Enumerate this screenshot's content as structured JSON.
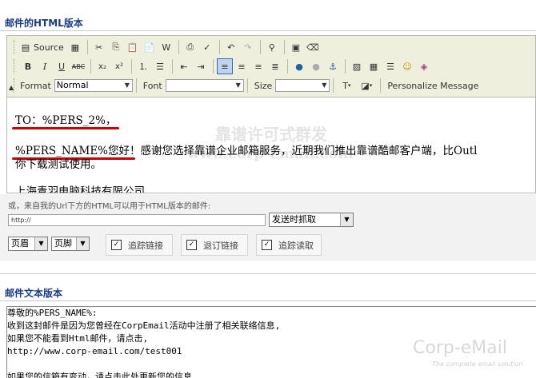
{
  "html_section": {
    "title": "邮件的HTML版本"
  },
  "toolbar": {
    "source_label": "Source",
    "format_label": "Format",
    "format_value": "Normal",
    "font_label": "Font",
    "font_value": "",
    "size_label": "Size",
    "size_value": "",
    "personalize_label": "Personalize Message"
  },
  "content": {
    "line1": "TO：%PERS_2%，",
    "line2_var": "%PERS_NAME%您好",
    "line2_rest": "！感谢您选择靠谱企业邮箱服务，近期我们推出靠谱酷邮客户端，比Outl",
    "line3": "你下载测试使用。",
    "line4": "上海青羽电脑科技有限公司",
    "watermark_cn": "靠谱许可式群发",
    "watermark_url": "www.corp-email.com"
  },
  "url_panel": {
    "label": "或，来自我的Url下方的HTML可以用于HTML版本的邮件:",
    "url_value": "http://",
    "fetch_select": "发送时抓取"
  },
  "options": {
    "header_select": "页眉",
    "footer_select": "页脚",
    "track_links": "追踪链接",
    "unsubscribe_link": "退订链接",
    "track_reads": "追踪读取"
  },
  "text_section": {
    "title": "邮件文本版本",
    "lines": [
      "尊敬的%PERS_NAME%:",
      "收到这封邮件是因为您曾经在CorpEmail活动中注册了相关联络信息,",
      "如果您不能看到Html邮件，请点击,",
      "http://www.corp-email.com/test001",
      "",
      "如果您的信箱有变动，请点击此处更新您的信息."
    ],
    "logo_text": "Corp-eMail",
    "logo_sub": "The complete email solution"
  }
}
